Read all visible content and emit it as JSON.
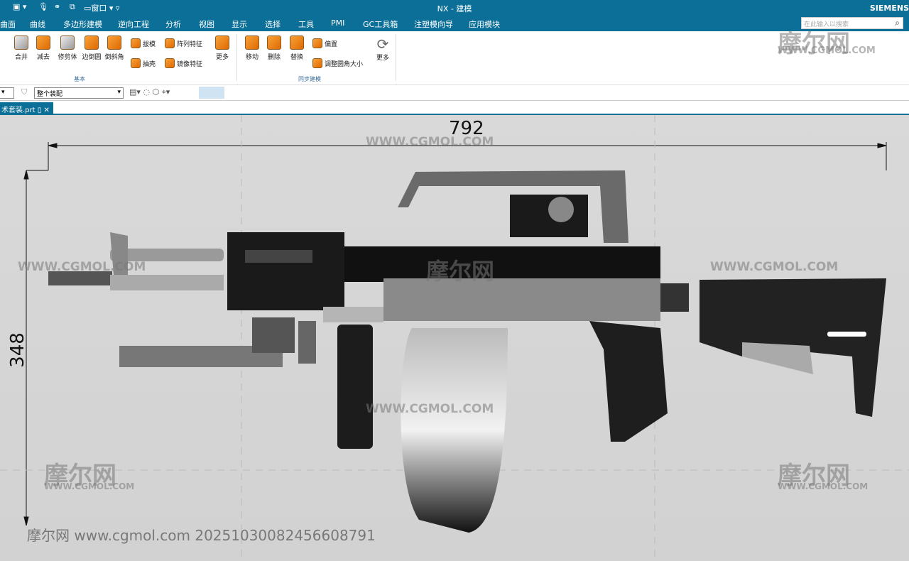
{
  "window": {
    "title": "NX - 建模",
    "brand": "SIEMENS",
    "quick_access": {
      "window_menu": "窗口"
    }
  },
  "menu": [
    "曲面",
    "曲线",
    "多边形建模",
    "逆向工程",
    "分析",
    "视图",
    "显示",
    "选择",
    "工具",
    "PMI",
    "GC工具箱",
    "注塑模向导",
    "应用模块"
  ],
  "search": {
    "placeholder": "在此输入以搜索"
  },
  "ribbon": {
    "basic": {
      "label": "基本",
      "buttons": [
        "合并",
        "减去",
        "修剪体",
        "边倒圆",
        "倒斜角"
      ],
      "small": [
        "拔模",
        "抽壳",
        "阵列特征",
        "镜像特征"
      ],
      "more": "更多"
    },
    "sync": {
      "label": "同步建模",
      "buttons": [
        "移动",
        "删除",
        "替换"
      ],
      "small": [
        "偏置",
        "调整圆角大小"
      ],
      "more": "更多"
    }
  },
  "toolbar": {
    "scope": "整个装配"
  },
  "file_tab": {
    "name": "术套装.prt"
  },
  "dimensions": {
    "width": "792",
    "height": "348"
  },
  "watermark": {
    "logo": "摩尔网",
    "url": "WWW.CGMOL.COM",
    "stamp": "摩尔网 www.cgmol.com 20251030082456608791"
  }
}
